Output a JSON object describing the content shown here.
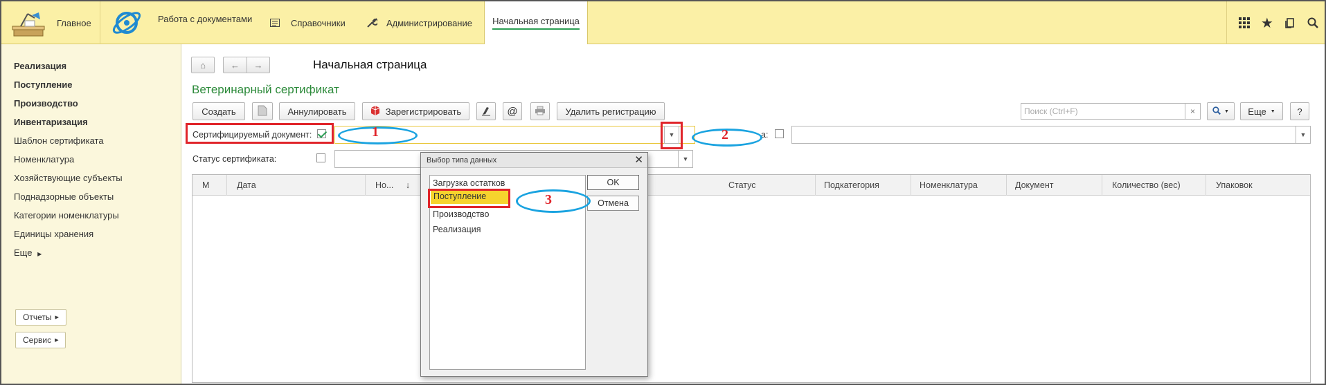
{
  "topbar": {
    "home_label": "Главное",
    "docs_label": "Работа с документами",
    "refs_label": "Справочники",
    "admin_label": "Администрирование",
    "start_tab_label": "Начальная страница"
  },
  "sidebar": {
    "items": [
      "Реализация",
      "Поступление",
      "Производство",
      "Инвентаризация",
      "Шаблон сертификата",
      "Номенклатура",
      "Хозяйствующие субъекты",
      "Поднадзорные объекты",
      "Категории номенклатуры",
      "Единицы хранения",
      "Еще"
    ],
    "reports_label": "Отчеты",
    "service_label": "Сервис"
  },
  "main": {
    "page_title": "Начальная страница",
    "form_title": "Ветеринарный сертификат",
    "toolbar": {
      "create": "Создать",
      "cancel_doc": "Аннулировать",
      "register": "Зарегистрировать",
      "email": "@",
      "delete_reg": "Удалить регистрацию",
      "search_placeholder": "Поиск (Ctrl+F)",
      "search_clear": "×",
      "more": "Еще",
      "help": "?"
    },
    "fields": {
      "cert_doc_label": "Сертифицируемый документ:",
      "cert_doc_checked": true,
      "partial_label": "а:",
      "status_label": "Статус сертификата:",
      "status_checked": false
    },
    "table": {
      "columns": [
        "М",
        "Дата",
        "Но...",
        "Статус",
        "Подкатегория",
        "Номенклатура",
        "Документ",
        "Количество (вес)",
        "Упаковок"
      ],
      "sort_arrow": "↓"
    }
  },
  "dialog": {
    "title": "Выбор типа данных",
    "items": [
      "Загрузка остатков",
      "Поступление",
      "Производство",
      "Реализация"
    ],
    "selected_index": 1,
    "ok_label": "OK",
    "cancel_label": "Отмена"
  },
  "annotations": [
    "1",
    "2",
    "3"
  ],
  "colors": {
    "topbar_bg": "#fbf0a6",
    "sidebar_bg": "#fbf7dc",
    "title_green": "#2c8a3a",
    "selection_yellow": "#f6d32d",
    "annotation_red": "#e0242a",
    "annotation_blue": "#1aa3e0"
  }
}
